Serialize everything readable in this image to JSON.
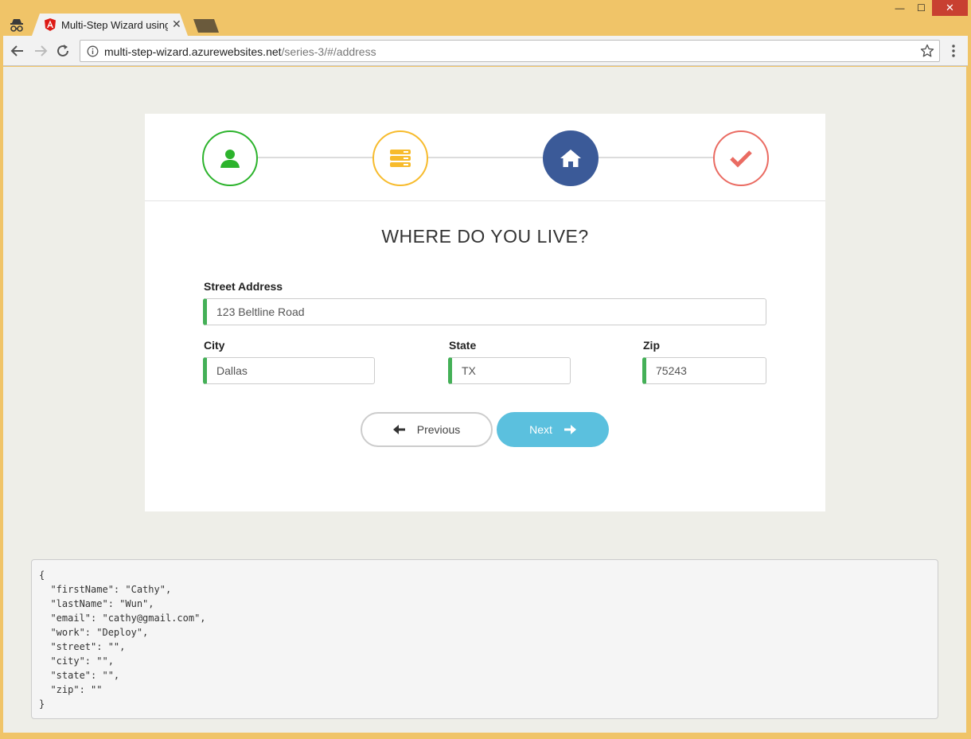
{
  "browser": {
    "tab_title": "Multi-Step Wizard using",
    "tab_close": "✕",
    "url_host": "multi-step-wizard.azurewebsites.net",
    "url_path": "/series-3/#/address",
    "window_controls": {
      "minimize": "—",
      "maximize": "☐",
      "close": "✕"
    }
  },
  "wizard": {
    "steps": [
      {
        "name": "profile",
        "icon": "user-icon",
        "color": "#2cb32c",
        "state": "done"
      },
      {
        "name": "work",
        "icon": "server-icon",
        "color": "#f7bb2c",
        "state": "done"
      },
      {
        "name": "address",
        "icon": "home-icon",
        "color": "#3b5a98",
        "state": "active"
      },
      {
        "name": "result",
        "icon": "check-icon",
        "color": "#ea6b62",
        "state": "pending"
      }
    ],
    "title": "WHERE DO YOU LIVE?",
    "fields": {
      "street": {
        "label": "Street Address",
        "value": "123 Beltline Road"
      },
      "city": {
        "label": "City",
        "value": "Dallas"
      },
      "state": {
        "label": "State",
        "value": "TX"
      },
      "zip": {
        "label": "Zip",
        "value": "75243"
      }
    },
    "buttons": {
      "previous": "Previous",
      "next": "Next"
    },
    "accent_colors": {
      "valid_border": "#44b057",
      "next_button": "#5bc0de"
    }
  },
  "debug_json": "{\n  \"firstName\": \"Cathy\",\n  \"lastName\": \"Wun\",\n  \"email\": \"cathy@gmail.com\",\n  \"work\": \"Deploy\",\n  \"street\": \"\",\n  \"city\": \"\",\n  \"state\": \"\",\n  \"zip\": \"\"\n}"
}
